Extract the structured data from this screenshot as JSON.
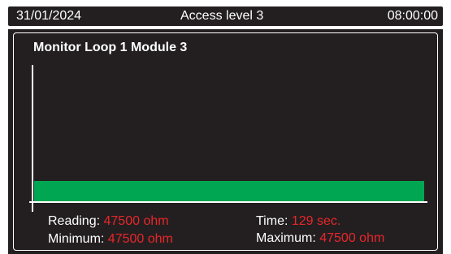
{
  "header": {
    "date": "31/01/2024",
    "access_level": "Access level 3",
    "time": "08:00:00"
  },
  "monitor": {
    "title": "Monitor Loop 1 Module 3",
    "level_fraction": 0.27,
    "bar_color": "#00a651",
    "reading_label": "Reading:",
    "reading_value": "47500 ohm",
    "minimum_label": "Minimum:",
    "minimum_value": "47500 ohm",
    "time_label": "Time:",
    "time_value": "129 sec.",
    "maximum_label": "Maximum:",
    "maximum_value": "47500 ohm"
  },
  "colors": {
    "background": "#231f20",
    "text": "#ffffff",
    "value": "#e8262b"
  }
}
